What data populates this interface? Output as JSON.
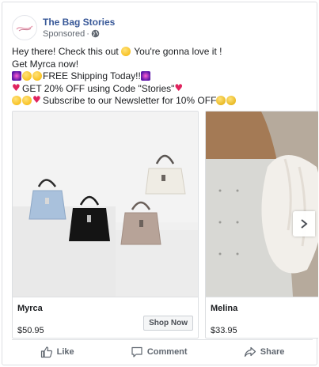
{
  "post": {
    "page_name": "The Bag Stories",
    "sponsored_label": "Sponsored",
    "separator": "·",
    "lines": [
      "Hey there! Check this out",
      "You're gonna love it !",
      "Get Myrca now!",
      "FREE Shipping Today!!",
      "GET 20% OFF using Code \"Stories\"",
      "Subscribe to our Newsletter for 10% OFF"
    ]
  },
  "carousel": {
    "items": [
      {
        "name": "Myrca",
        "price": "$50.95",
        "cta": "Shop Now"
      },
      {
        "name": "Melina",
        "price": "$33.95"
      }
    ],
    "next_icon": "chevron-right-icon"
  },
  "actions": {
    "like": "Like",
    "comment": "Comment",
    "share": "Share"
  },
  "colors": {
    "page_name": "#385898",
    "secondary_text": "#606770",
    "border": "#dddfe2"
  }
}
